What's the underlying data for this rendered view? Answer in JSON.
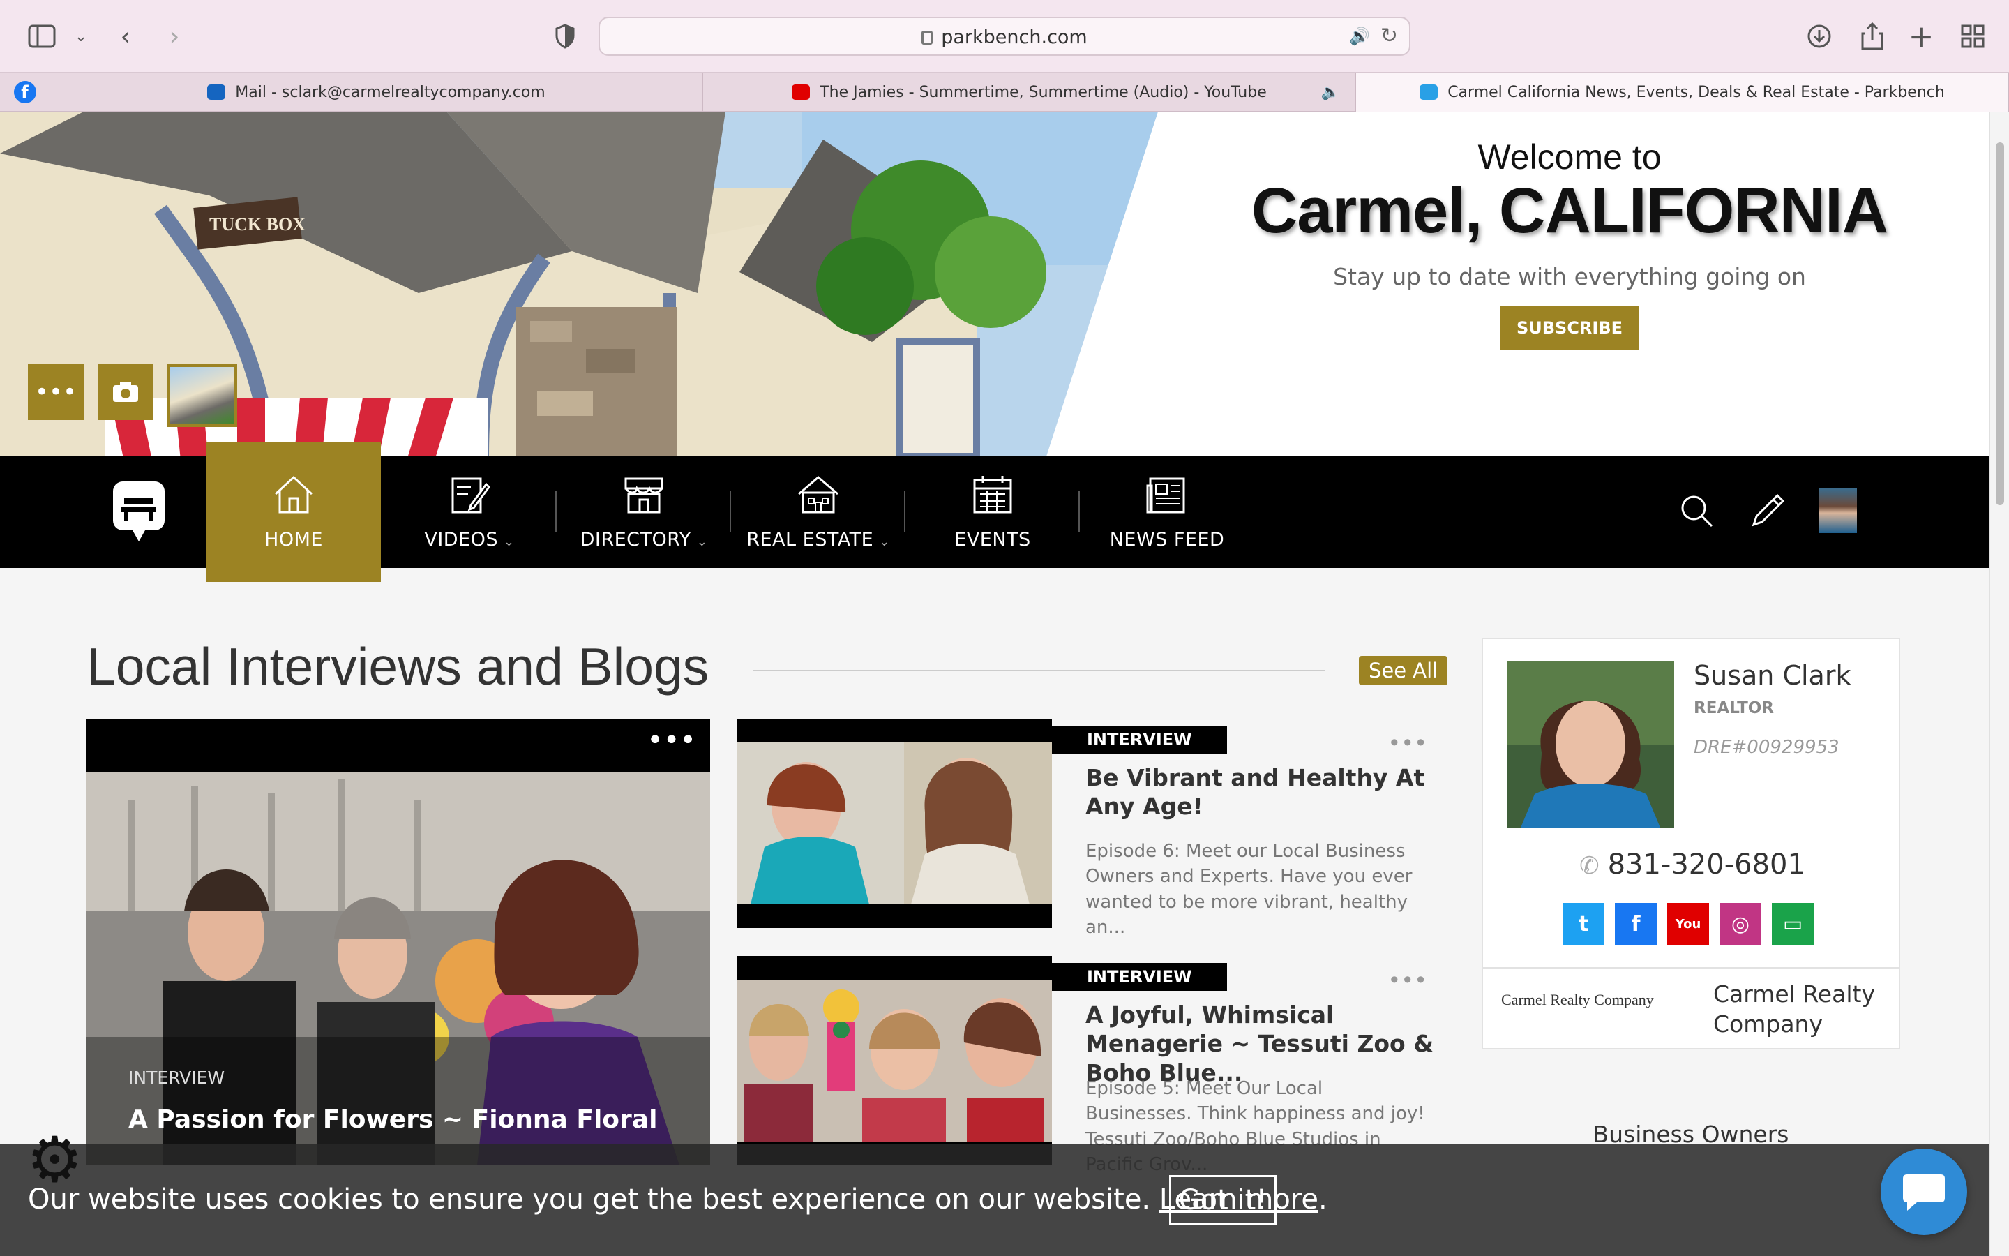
{
  "browser": {
    "url": "parkbench.com",
    "tabs": [
      {
        "label": "Mail - sclark@carmelrealtycompany.com",
        "favicon": "outlook-icon"
      },
      {
        "label": "The Jamies - Summertime, Summertime (Audio) - YouTube",
        "favicon": "youtube-icon"
      },
      {
        "label": "Carmel California News, Events, Deals & Real Estate - Parkbench",
        "favicon": "parkbench-icon"
      }
    ]
  },
  "hero": {
    "welcome": "Welcome to",
    "city": "Carmel, CALIFORNIA",
    "tagline": "Stay up to date with everything going on",
    "subscribe_label": "SUBSCRIBE",
    "sign_text": "TUCK BOX"
  },
  "nav": {
    "items": [
      {
        "label": "HOME",
        "icon": "house-icon"
      },
      {
        "label": "VIDEOS",
        "icon": "edit-icon"
      },
      {
        "label": "DIRECTORY",
        "icon": "storefront-icon"
      },
      {
        "label": "REAL ESTATE",
        "icon": "building-icon"
      },
      {
        "label": "EVENTS",
        "icon": "calendar-icon"
      },
      {
        "label": "NEWS FEED",
        "icon": "newspaper-icon"
      }
    ]
  },
  "main": {
    "section_title": "Local Interviews and Blogs",
    "see_all": "See All",
    "feature": {
      "category": "INTERVIEW",
      "title": "A Passion for Flowers ~ Fionna Floral"
    },
    "cards": [
      {
        "badge": "INTERVIEW",
        "title": "Be Vibrant and Healthy At Any Age!",
        "desc": "Episode 6: Meet our Local Business Owners and Experts. Have you ever wanted to be more vibrant, healthy an..."
      },
      {
        "badge": "INTERVIEW",
        "title": "A Joyful, Whimsical Menagerie ~ Tessuti Zoo & Boho Blue...",
        "desc": "Episode 5: Meet Our Local Businesses. Think happiness and joy! Tessuti Zoo/Boho Blue Studios in Pacific Grov..."
      }
    ]
  },
  "agent": {
    "name": "Susan Clark",
    "role": "REALTOR",
    "dre": "DRE#00929953",
    "phone": "831-320-6801",
    "company_logo": "Carmel Realty Company",
    "company_name": "Carmel Realty Company",
    "socials": [
      {
        "name": "twitter-icon",
        "glyph": "t",
        "color": "#1da1f2"
      },
      {
        "name": "facebook-icon",
        "glyph": "f",
        "color": "#1877f2"
      },
      {
        "name": "youtube-icon",
        "glyph": "You",
        "color": "#e00000"
      },
      {
        "name": "instagram-icon",
        "glyph": "◎",
        "color": "#c13584"
      },
      {
        "name": "website-icon",
        "glyph": "▭",
        "color": "#1aa34a"
      }
    ]
  },
  "sidebar": {
    "business_owners": "Business Owners"
  },
  "cookie": {
    "text": "Our website uses cookies to ensure you get the best experience on our website.",
    "learn_more": "Learn more",
    "period": ".",
    "button": "Got it!"
  },
  "colors": {
    "accent": "#9c8323",
    "nav_bg": "#000000",
    "chat": "#2f8bd6"
  }
}
